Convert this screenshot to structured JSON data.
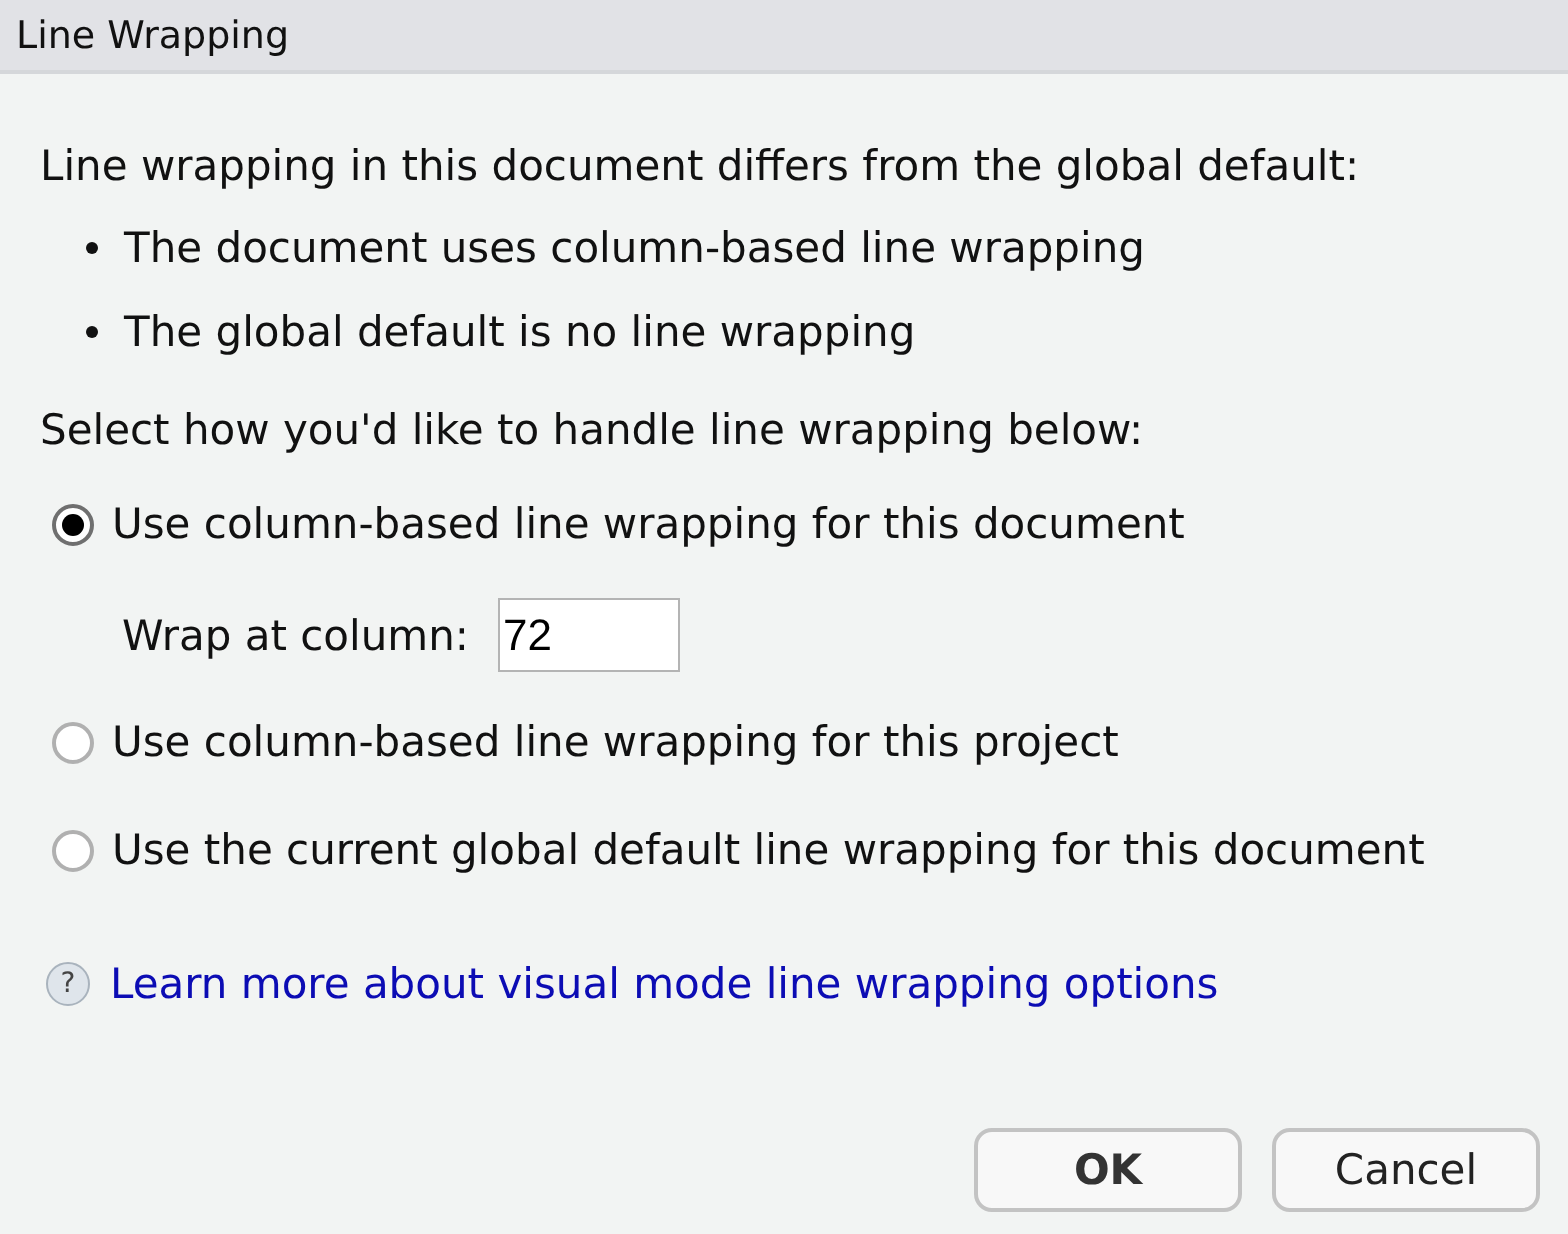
{
  "window": {
    "title": "Line Wrapping"
  },
  "message": {
    "text": "Line wrapping in this document differs from the global default:",
    "bullets": [
      "The document uses column-based line wrapping",
      "The global default is no line wrapping"
    ]
  },
  "prompt": "Select how you'd like to handle line wrapping below:",
  "options": [
    {
      "label": "Use column-based line wrapping for this document",
      "selected": true,
      "field": {
        "label": "Wrap at column:",
        "value": "72"
      }
    },
    {
      "label": "Use column-based line wrapping for this project",
      "selected": false
    },
    {
      "label": "Use the current global default line wrapping for this document",
      "selected": false
    }
  ],
  "help_link": {
    "icon": "?",
    "text": "Learn more about visual mode line wrapping options"
  },
  "buttons": [
    {
      "label": "OK",
      "default": true
    },
    {
      "label": "Cancel",
      "default": false
    }
  ]
}
